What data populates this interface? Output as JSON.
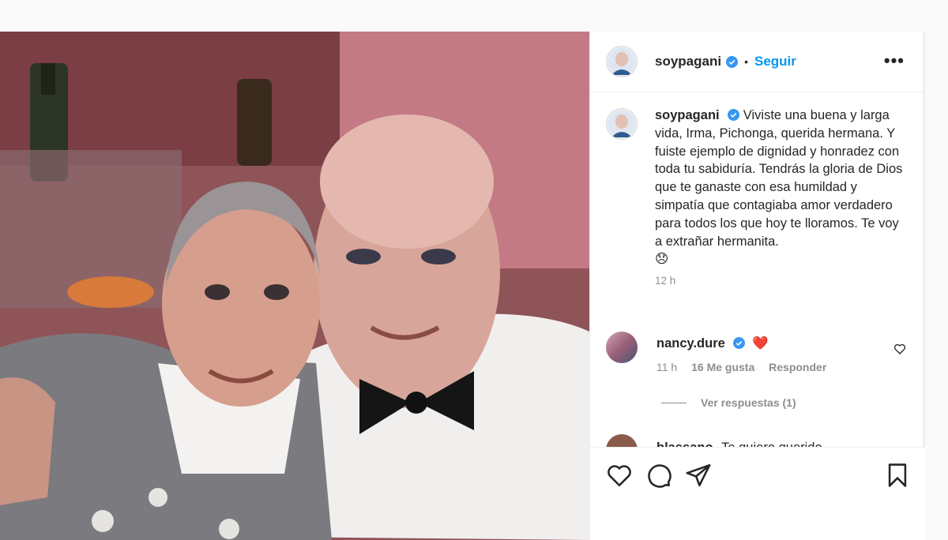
{
  "post": {
    "photo_alt": "",
    "author": "soypagani",
    "follow_label": "Seguir",
    "separator": "•",
    "more_label": "•••",
    "caption": "Viviste una buena y larga vida, Irma, Pichonga, querida hermana. Y fuiste ejemplo de dignidad y honradez con toda tu sabiduría. Tendrás la gloria de Dios que te ganaste con esa humildad y simpatía que contagiaba amor verdadero para todos los que hoy te lloramos. Te voy a extrañar hermanita.",
    "caption_emoji": "😞",
    "time": "12 h"
  },
  "comments": [
    {
      "user": "nancy.dure",
      "text": "❤️",
      "time": "11 h",
      "likes": "16 Me gusta",
      "reply_label": "Responder",
      "view_replies": "Ver respuestas (1)"
    }
  ],
  "peek_comment": {
    "user": "blassano",
    "text": "Te quiero querido"
  },
  "colors": {
    "accent": "#0095f6",
    "verified": "#3897f0",
    "heart": "#ed4956"
  },
  "icons": [
    "verified-badge-icon",
    "more-options-icon",
    "heart-icon",
    "comment-icon",
    "share-icon",
    "bookmark-icon"
  ]
}
